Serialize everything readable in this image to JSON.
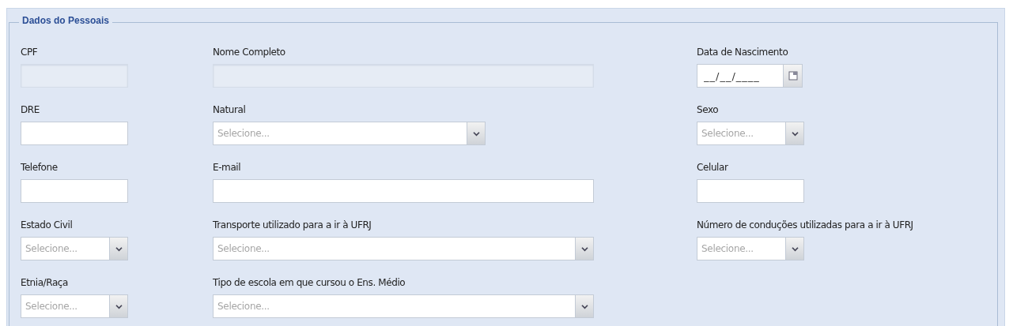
{
  "fieldset": {
    "legend": "Dados do Pessoais"
  },
  "rows": [
    {
      "col_1": {
        "label": "CPF",
        "kind": "text",
        "disabled": true
      },
      "col_2": {
        "label": "Nome Completo",
        "kind": "text",
        "disabled": true,
        "wide": true
      },
      "col_3": {
        "label": "Data de Nascimento",
        "kind": "date",
        "value": "__/__/____"
      }
    },
    {
      "col_1": {
        "label": "DRE",
        "kind": "text",
        "disabled": false
      },
      "col_2": {
        "label": "Natural",
        "kind": "select",
        "placeholder": "Selecione...",
        "wide": false
      },
      "col_3": {
        "label": "Sexo",
        "kind": "select",
        "placeholder": "Selecione..."
      }
    },
    {
      "col_1": {
        "label": "Telefone",
        "kind": "text",
        "disabled": false
      },
      "col_2": {
        "label": "E-mail",
        "kind": "text",
        "disabled": false,
        "wide": true
      },
      "col_3": {
        "label": "Celular",
        "kind": "text",
        "disabled": false
      }
    },
    {
      "col_1": {
        "label": "Estado Civil",
        "kind": "select",
        "placeholder": "Selecione..."
      },
      "col_2": {
        "label": "Transporte utilizado para a ir à UFRJ",
        "kind": "select",
        "placeholder": "Selecione...",
        "wide": true
      },
      "col_3": {
        "label": "Número de conduções utilizadas para a ir à UFRJ",
        "kind": "select",
        "placeholder": "Selecione..."
      }
    },
    {
      "col_1": {
        "label": "Etnia/Raça",
        "kind": "select",
        "placeholder": "Selecione..."
      },
      "col_2": {
        "label": "Tipo de escola em que cursou o Ens. Médio",
        "kind": "select",
        "placeholder": "Selecione...",
        "wide": true
      }
    }
  ]
}
